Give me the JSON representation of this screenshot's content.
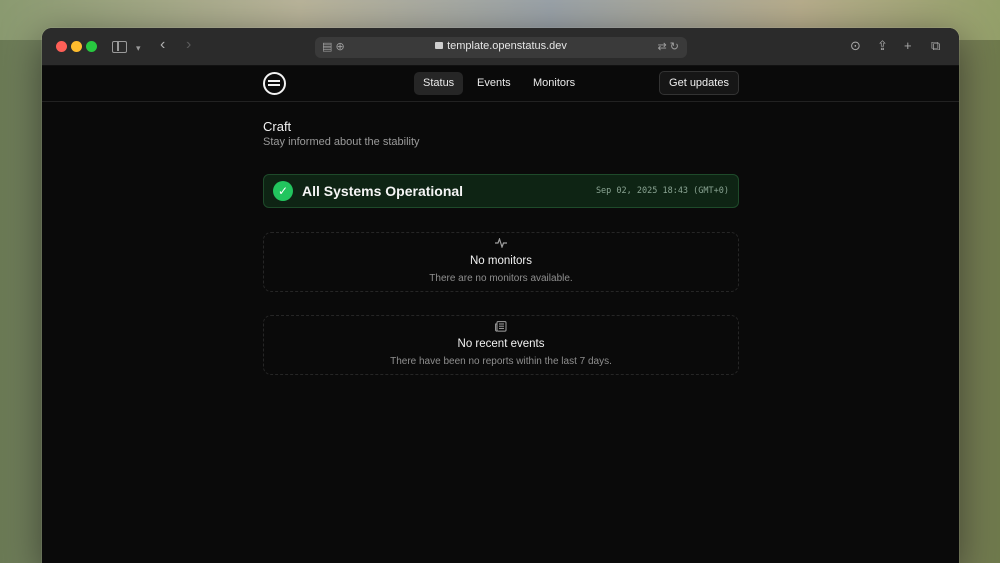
{
  "browser": {
    "url": "template.openstatus.dev",
    "icons": [
      "sidebar-icon",
      "chevron-down-icon",
      "back-icon",
      "forward-icon",
      "reader-icon",
      "extension-icon",
      "lock-icon",
      "translate-icon",
      "reload-icon",
      "download-icon",
      "share-icon",
      "new-tab-icon",
      "tabs-overview-icon"
    ]
  },
  "header": {
    "nav": [
      {
        "label": "Status",
        "active": true
      },
      {
        "label": "Events",
        "active": false
      },
      {
        "label": "Monitors",
        "active": false
      }
    ],
    "cta_label": "Get updates"
  },
  "page": {
    "title": "Craft",
    "subtitle": "Stay informed about the stability"
  },
  "status": {
    "text": "All Systems Operational",
    "timestamp": "Sep 02, 2025 18:43 (GMT+0)",
    "color": "#22c55e"
  },
  "monitors_empty": {
    "icon": "activity-icon",
    "title": "No monitors",
    "description": "There are no monitors available."
  },
  "events_empty": {
    "icon": "newspaper-icon",
    "title": "No recent events",
    "description": "There have been no reports within the last 7 days."
  }
}
